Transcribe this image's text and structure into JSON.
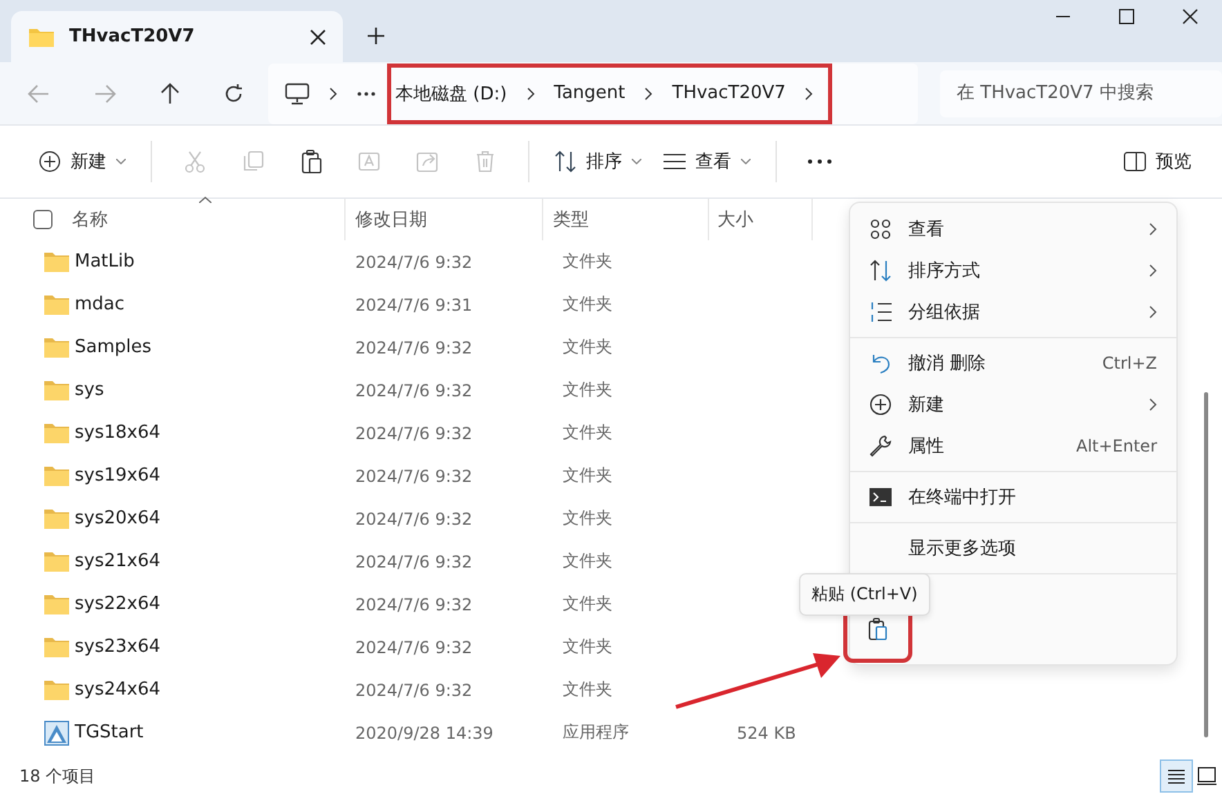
{
  "tab": {
    "title": "THvacT20V7"
  },
  "address": {
    "crumbs": [
      "本地磁盘 (D:)",
      "Tangent",
      "THvacT20V7"
    ],
    "highlighted": true
  },
  "search": {
    "placeholder": "在 THvacT20V7 中搜索"
  },
  "toolbar": {
    "new_label": "新建",
    "sort_label": "排序",
    "view_label": "查看",
    "preview_label": "预览",
    "tools": [
      {
        "disabled": true
      },
      {
        "disabled": true
      },
      {
        "disabled": false
      },
      {
        "disabled": true
      },
      {
        "disabled": true
      },
      {
        "disabled": true
      }
    ]
  },
  "columns": [
    "名称",
    "修改日期",
    "类型",
    "大小"
  ],
  "select_all": {
    "checked": false
  },
  "rows": [
    {
      "kind": "folder",
      "name": "MatLib",
      "date": "2024/7/6 9:32",
      "type": "文件夹"
    },
    {
      "kind": "folder",
      "name": "mdac",
      "date": "2024/7/6 9:31",
      "type": "文件夹"
    },
    {
      "kind": "folder",
      "name": "Samples",
      "date": "2024/7/6 9:32",
      "type": "文件夹"
    },
    {
      "kind": "folder",
      "name": "sys",
      "date": "2024/7/6 9:32",
      "type": "文件夹"
    },
    {
      "kind": "folder",
      "name": "sys18x64",
      "date": "2024/7/6 9:32",
      "type": "文件夹"
    },
    {
      "kind": "folder",
      "name": "sys19x64",
      "date": "2024/7/6 9:32",
      "type": "文件夹"
    },
    {
      "kind": "folder",
      "name": "sys20x64",
      "date": "2024/7/6 9:32",
      "type": "文件夹"
    },
    {
      "kind": "folder",
      "name": "sys21x64",
      "date": "2024/7/6 9:32",
      "type": "文件夹"
    },
    {
      "kind": "folder",
      "name": "sys22x64",
      "date": "2024/7/6 9:32",
      "type": "文件夹"
    },
    {
      "kind": "folder",
      "name": "sys23x64",
      "date": "2024/7/6 9:32",
      "type": "文件夹"
    },
    {
      "kind": "folder",
      "name": "sys24x64",
      "date": "2024/7/6 9:32",
      "type": "文件夹"
    },
    {
      "kind": "app",
      "name": "TGStart",
      "date": "2020/9/28 14:39",
      "type": "应用程序",
      "size": "524 KB"
    }
  ],
  "status": "18 个项目",
  "context_menu": {
    "items": [
      {
        "kind": "item",
        "label": "查看",
        "submenu": true
      },
      {
        "kind": "item",
        "label": "排序方式",
        "submenu": true
      },
      {
        "kind": "item",
        "label": "分组依据",
        "submenu": true
      },
      {
        "kind": "separator"
      },
      {
        "kind": "item",
        "label": "撤消 删除",
        "shortcut": "Ctrl+Z",
        "submenu": false
      },
      {
        "kind": "item",
        "label": "新建",
        "submenu": true
      },
      {
        "kind": "item",
        "label": "属性",
        "shortcut": "Alt+Enter",
        "submenu": false
      },
      {
        "kind": "separator"
      },
      {
        "kind": "item",
        "label": "在终端中打开",
        "submenu": false
      },
      {
        "kind": "separator"
      },
      {
        "kind": "item",
        "label": "显示更多选项",
        "submenu": false
      },
      {
        "kind": "separator"
      }
    ],
    "paste_highlighted": true
  },
  "tooltip": "粘贴 (Ctrl+V)",
  "callout_arrow": true
}
